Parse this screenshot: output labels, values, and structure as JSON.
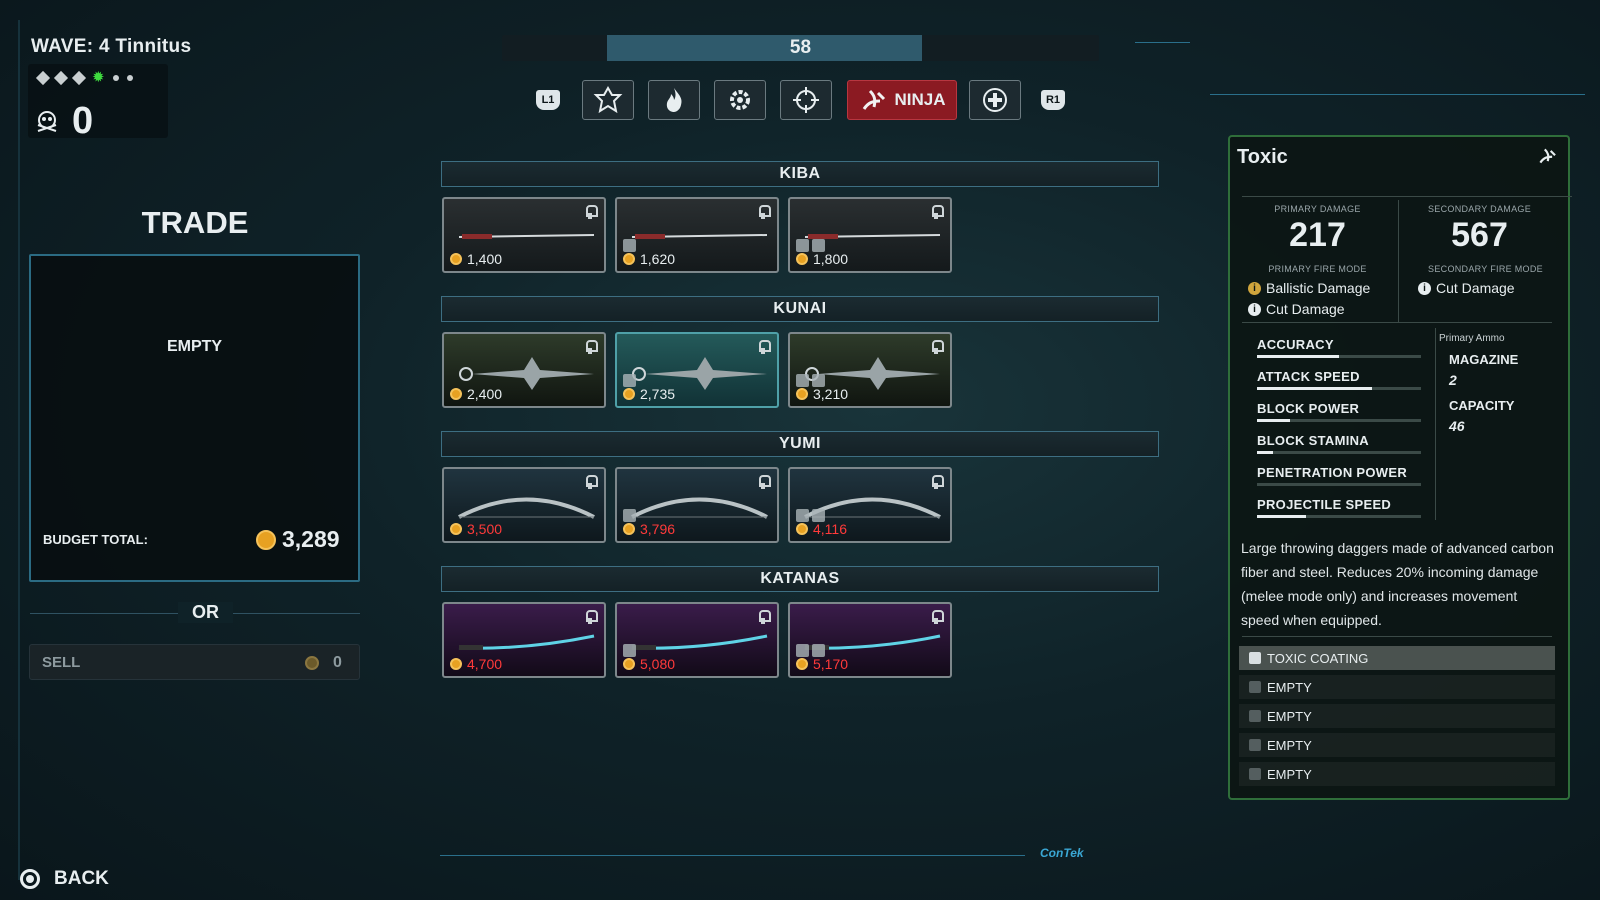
{
  "hud": {
    "wave_label": "WAVE: 4 Tinnitus",
    "kills": "0",
    "timer": "58",
    "timer_progress": 0.64
  },
  "top_nav": {
    "left_button": "L1",
    "right_button": "R1",
    "active_class": "NINJA",
    "classes": [
      "emblem-icon",
      "flame-icon",
      "gear-icon",
      "crosshair-icon",
      "ninja-icon",
      "medic-cross-icon"
    ]
  },
  "trade": {
    "title": "TRADE",
    "empty_label": "EMPTY",
    "budget_label": "BUDGET TOTAL:",
    "budget_value": "3,289",
    "or_label": "OR",
    "sell_label": "SELL",
    "sell_value": "0"
  },
  "shop": {
    "sections": [
      {
        "title": "KIBA",
        "items": [
          {
            "price": "1,400",
            "affordable": true
          },
          {
            "price": "1,620",
            "affordable": true
          },
          {
            "price": "1,800",
            "affordable": true
          }
        ]
      },
      {
        "title": "KUNAI",
        "items": [
          {
            "price": "2,400",
            "affordable": true
          },
          {
            "price": "2,735",
            "affordable": true,
            "selected": true
          },
          {
            "price": "3,210",
            "affordable": true
          }
        ]
      },
      {
        "title": "YUMI",
        "items": [
          {
            "price": "3,500",
            "affordable": false
          },
          {
            "price": "3,796",
            "affordable": false
          },
          {
            "price": "4,116",
            "affordable": false
          }
        ]
      },
      {
        "title": "KATANAS",
        "items": [
          {
            "price": "4,700",
            "affordable": false
          },
          {
            "price": "5,080",
            "affordable": false
          },
          {
            "price": "5,170",
            "affordable": false
          }
        ]
      }
    ]
  },
  "details": {
    "title": "Toxic",
    "primary_damage_label": "PRIMARY DAMAGE",
    "primary_damage": "217",
    "secondary_damage_label": "SECONDARY DAMAGE",
    "secondary_damage": "567",
    "primary_fire_mode_label": "PRIMARY FIRE MODE",
    "primary_modes": [
      "Ballistic Damage",
      "Cut Damage"
    ],
    "secondary_fire_mode_label": "SECONDARY FIRE MODE",
    "secondary_modes": [
      "Cut Damage"
    ],
    "stats": [
      {
        "label": "ACCURACY",
        "value": 0.5
      },
      {
        "label": "ATTACK SPEED",
        "value": 0.7
      },
      {
        "label": "BLOCK POWER",
        "value": 0.2
      },
      {
        "label": "BLOCK STAMINA",
        "value": 0.1
      },
      {
        "label": "PENETRATION POWER",
        "value": 0.0
      },
      {
        "label": "PROJECTILE SPEED",
        "value": 0.3
      }
    ],
    "ammo_label": "Primary Ammo",
    "magazine_label": "MAGAZINE",
    "magazine_value": "2",
    "capacity_label": "CAPACITY",
    "capacity_value": "46",
    "description": "Large throwing daggers made of advanced carbon fiber and steel. Reduces 20% incoming damage (melee mode only) and increases movement speed when equipped.",
    "slots": [
      "TOXIC COATING",
      "EMPTY",
      "EMPTY",
      "EMPTY",
      "EMPTY"
    ]
  },
  "footer": {
    "back_label": "BACK",
    "brand": "ConTek"
  },
  "colors": {
    "accent": "#2b6b83",
    "unaffordable": "#ff3a3a",
    "coin": "#e7a122",
    "ninja_active": "#8b1a22"
  }
}
